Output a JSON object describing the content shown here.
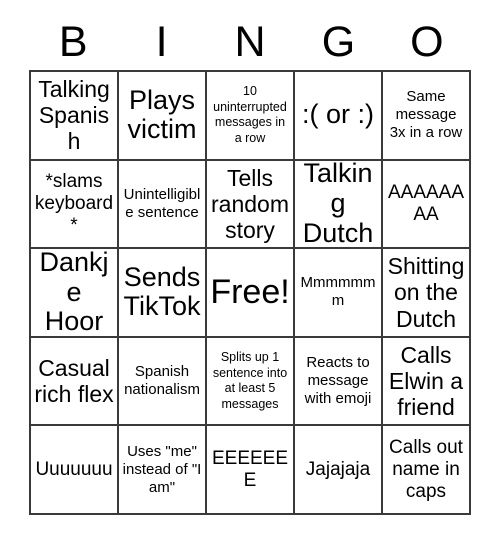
{
  "card": {
    "title": "BINGO",
    "header_letters": [
      "B",
      "I",
      "N",
      "G",
      "O"
    ],
    "rows": [
      [
        {
          "text": "Talking Spanish",
          "size": "lg"
        },
        {
          "text": "Plays victim",
          "size": "xl"
        },
        {
          "text": "10 uninterrupted messages in a row",
          "size": "xs"
        },
        {
          "text": ":( or :)",
          "size": "xl"
        },
        {
          "text": "Same message 3x in a row",
          "size": "sm"
        }
      ],
      [
        {
          "text": "*slams keyboard*",
          "size": "md"
        },
        {
          "text": "Unintelligible sentence",
          "size": "sm"
        },
        {
          "text": "Tells random story",
          "size": "lg"
        },
        {
          "text": "Talking Dutch",
          "size": "xl"
        },
        {
          "text": "AAAAAAAA",
          "size": "md"
        }
      ],
      [
        {
          "text": "Dankje Hoor",
          "size": "xl"
        },
        {
          "text": "Sends TikTok",
          "size": "xl"
        },
        {
          "text": "Free!",
          "size": "xxl"
        },
        {
          "text": "Mmmmmmm",
          "size": "sm"
        },
        {
          "text": "Shitting on the Dutch",
          "size": "lg"
        }
      ],
      [
        {
          "text": "Casual rich flex",
          "size": "lg"
        },
        {
          "text": "Spanish nationalism",
          "size": "sm"
        },
        {
          "text": "Splits up 1 sentence into at least 5 messages",
          "size": "xs"
        },
        {
          "text": "Reacts to message with emoji",
          "size": "sm"
        },
        {
          "text": "Calls Elwin a friend",
          "size": "lg"
        }
      ],
      [
        {
          "text": "Uuuuuuu",
          "size": "md"
        },
        {
          "text": "Uses \"me\" instead of \"I am\"",
          "size": "sm"
        },
        {
          "text": "EEEEEEE",
          "size": "md"
        },
        {
          "text": "Jajajaja",
          "size": "md"
        },
        {
          "text": "Calls out name in caps",
          "size": "md"
        }
      ]
    ]
  },
  "colors": {
    "background": "#ffffff",
    "text": "#000000",
    "grid_border": "#3a3a3a"
  }
}
